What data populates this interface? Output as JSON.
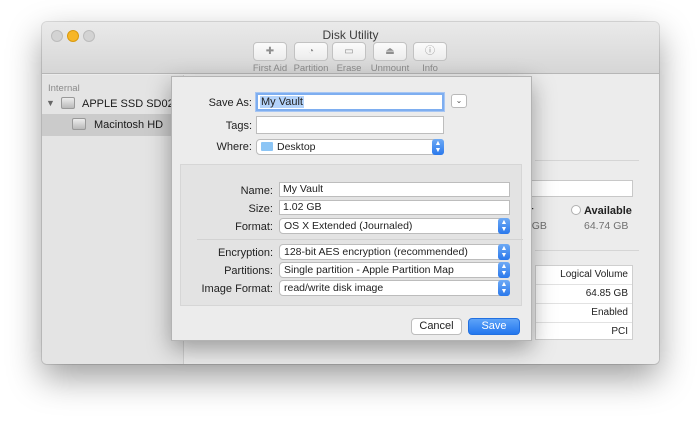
{
  "window": {
    "title": "Disk Utility",
    "toolbar": [
      {
        "label": "First Aid",
        "icon": "stethoscope-icon",
        "glyph": "✚"
      },
      {
        "label": "Partition",
        "icon": "partition-icon",
        "glyph": "◔"
      },
      {
        "label": "Erase",
        "icon": "erase-icon",
        "glyph": "▭"
      },
      {
        "label": "Unmount",
        "icon": "unmount-icon",
        "glyph": "⏏"
      },
      {
        "label": "Info",
        "icon": "info-icon",
        "glyph": "ⓘ"
      }
    ]
  },
  "sidebar": {
    "header": "Internal",
    "disk_label": "APPLE SSD SD02...",
    "volume_label": "Macintosh HD"
  },
  "content": {
    "used_partial": "er",
    "used_value_partial": "7 GB",
    "available_label": "Available",
    "available_value": "64.74 GB",
    "table": [
      "Logical Volume",
      "64.85 GB",
      "Enabled",
      "PCI"
    ]
  },
  "sheet": {
    "save_as_label": "Save As:",
    "save_as_value": "My Vault",
    "tags_label": "Tags:",
    "tags_value": "",
    "where_label": "Where:",
    "where_value": "Desktop",
    "name_label": "Name:",
    "name_value": "My Vault",
    "size_label": "Size:",
    "size_value": "1.02 GB",
    "format_label": "Format:",
    "format_value": "OS X Extended (Journaled)",
    "encryption_label": "Encryption:",
    "encryption_value": "128-bit AES encryption (recommended)",
    "partitions_label": "Partitions:",
    "partitions_value": "Single partition - Apple Partition Map",
    "image_format_label": "Image Format:",
    "image_format_value": "read/write disk image",
    "cancel_label": "Cancel",
    "save_label": "Save"
  },
  "colors": {
    "accent": "#2377ee",
    "minimize": "#f7b627",
    "selection": "#b4d3fa"
  }
}
